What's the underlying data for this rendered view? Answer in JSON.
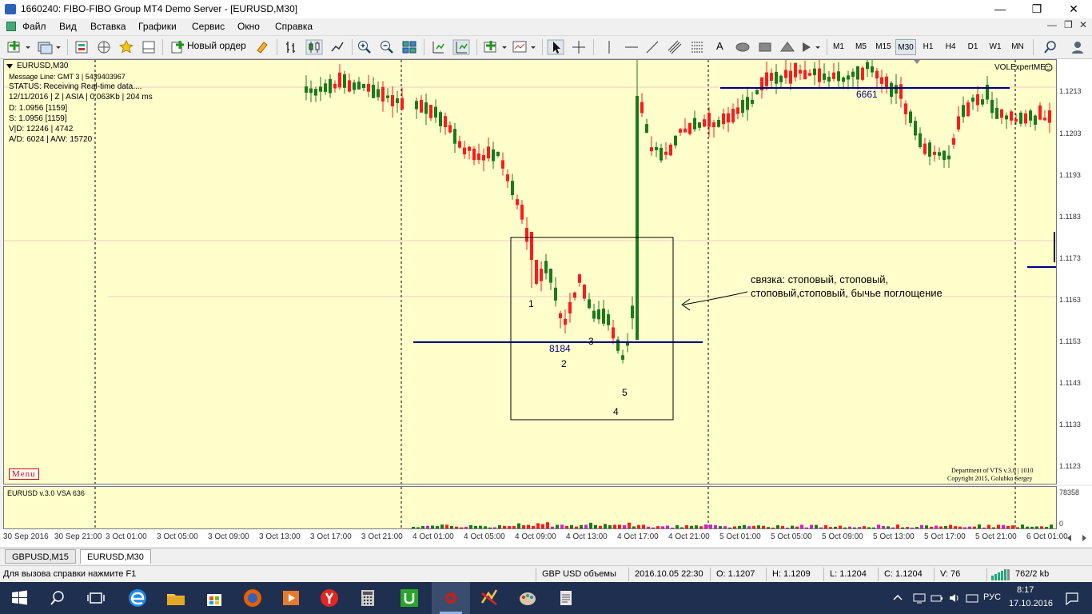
{
  "window": {
    "title": "1660240: FIBO-FIBO Group MT4 Demo Server - [EURUSD,M30]"
  },
  "menu": [
    "Файл",
    "Вид",
    "Вставка",
    "Графики",
    "Сервис",
    "Окно",
    "Справка"
  ],
  "toolbar": {
    "new_order": "Новый ордер",
    "timeframes": [
      "M1",
      "M5",
      "M15",
      "M30",
      "H1",
      "H4",
      "D1",
      "W1",
      "MN"
    ],
    "active_timeframe": "M30",
    "text_tool": "A"
  },
  "chart": {
    "symbol": "EURUSD,M30",
    "info_lines": [
      "Message Line: GMT 3 | 5439403967",
      "STATUS:  Receiving Real-time data....",
      "12/11/2016 | Z | ASIA | 0.063Kb | 204 ms",
      "D: 1.0956  [1159]",
      "S: 1.0956  [1159]",
      "V|D: 12246 | 4742",
      "A/D: 6024 | A/W: 15720"
    ],
    "brand": "VOLExpertME",
    "menu_button": "Menu",
    "footer_lines": [
      "Department of VTS  v.3.0 | 1010",
      "Copyright 2015, Golubko Sergey"
    ],
    "price_labels": [
      "1.1213",
      "1.1203",
      "1.1193",
      "1.1183",
      "1.1173",
      "1.1163",
      "1.1153",
      "1.1143",
      "1.1133",
      "1.1123"
    ],
    "level_labels": [
      "6661",
      "8184"
    ],
    "candle_numbers": [
      "1",
      "2",
      "3",
      "4",
      "5"
    ],
    "annotation": [
      "связка: стоповый, стоповый,",
      "стоповый,стоповый, бычье поглощение"
    ],
    "time_labels": [
      "30 Sep 2016",
      "30 Sep 21:00",
      "3 Oct 01:00",
      "3 Oct 05:00",
      "3 Oct 09:00",
      "3 Oct 13:00",
      "3 Oct 17:00",
      "3 Oct 21:00",
      "4 Oct 01:00",
      "4 Oct 05:00",
      "4 Oct 09:00",
      "4 Oct 13:00",
      "4 Oct 17:00",
      "4 Oct 21:00",
      "5 Oct 01:00",
      "5 Oct 05:00",
      "5 Oct 09:00",
      "5 Oct 13:00",
      "5 Oct 17:00",
      "5 Oct 21:00",
      "6 Oct 01:00"
    ],
    "colors": {
      "bull": "#1a7a1a",
      "bear": "#ff1a1a",
      "background": "#ffffcc",
      "level": "#000080"
    }
  },
  "volume": {
    "title": "EURUSD v.3.0 VSA 636",
    "max_label": "78358",
    "min_label": "0"
  },
  "tabs": [
    "GBPUSD,M15",
    "EURUSD,M30"
  ],
  "active_tab": "EURUSD,M30",
  "status": {
    "help": "Для вызова справки нажмите F1",
    "profile": "GBP USD объемы",
    "datetime": "2016.10.05 22:30",
    "open": "O: 1.1207",
    "high": "H: 1.1209",
    "low": "L: 1.1204",
    "close": "C: 1.1204",
    "volume": "V: 76",
    "traffic": "762/2 kb"
  },
  "taskbar": {
    "lang": "РУС",
    "time": "8:17",
    "date": "17.10.2016"
  }
}
